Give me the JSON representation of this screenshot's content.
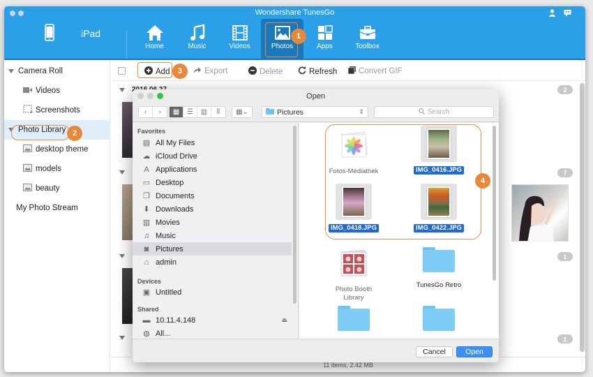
{
  "window": {
    "title": "Wondershare TunesGo",
    "device_label": "iPad"
  },
  "nav": [
    {
      "label": "Home",
      "icon": "home-icon"
    },
    {
      "label": "Music",
      "icon": "music-icon"
    },
    {
      "label": "Videos",
      "icon": "film-icon"
    },
    {
      "label": "Photos",
      "icon": "photo-icon",
      "active": true
    },
    {
      "label": "Apps",
      "icon": "apps-icon"
    },
    {
      "label": "Toolbox",
      "icon": "toolbox-icon"
    }
  ],
  "callouts": {
    "one": "1",
    "two": "2",
    "three": "3",
    "four": "4"
  },
  "sidebar": {
    "items": [
      {
        "label": "Camera Roll",
        "icon": "triangle-icon"
      },
      {
        "label": "Videos",
        "icon": "video-camera-icon"
      },
      {
        "label": "Screenshots",
        "icon": "screenshot-icon"
      },
      {
        "label": "Photo Library",
        "icon": "triangle-icon",
        "selected": true
      },
      {
        "label": "desktop theme",
        "icon": "album-icon"
      },
      {
        "label": "models",
        "icon": "album-icon"
      },
      {
        "label": "beauty",
        "icon": "album-icon"
      },
      {
        "label": "My Photo Stream",
        "icon": ""
      }
    ]
  },
  "toolbar": {
    "add": "Add",
    "export": "Export",
    "delete": "Delete",
    "refresh": "Refresh",
    "convert_gif": "Convert GIF"
  },
  "content": {
    "groups": [
      {
        "date": "2016.06.27",
        "count": "2"
      },
      {
        "date": "",
        "count": "7"
      },
      {
        "date": "",
        "count": "1"
      },
      {
        "date": "",
        "count": "1"
      }
    ],
    "status": "11 items, 2.42 MB"
  },
  "dialog": {
    "title": "Open",
    "location": "Pictures",
    "search_placeholder": "Search",
    "sections": {
      "favorites": "Favorites",
      "devices": "Devices",
      "shared": "Shared"
    },
    "favorites": [
      {
        "label": "All My Files",
        "icon": "all-files-icon"
      },
      {
        "label": "iCloud Drive",
        "icon": "cloud-icon"
      },
      {
        "label": "Applications",
        "icon": "applications-icon"
      },
      {
        "label": "Desktop",
        "icon": "desktop-icon"
      },
      {
        "label": "Documents",
        "icon": "documents-icon"
      },
      {
        "label": "Downloads",
        "icon": "downloads-icon"
      },
      {
        "label": "Movies",
        "icon": "movies-icon"
      },
      {
        "label": "Music",
        "icon": "music-icon"
      },
      {
        "label": "Pictures",
        "icon": "camera-icon",
        "selected": true
      },
      {
        "label": "admin",
        "icon": "home-icon"
      }
    ],
    "devices": [
      {
        "label": "Untitled",
        "icon": "disk-icon"
      }
    ],
    "shared": [
      {
        "label": "10.11.4.148",
        "icon": "monitor-icon"
      },
      {
        "label": "All...",
        "icon": "globe-icon"
      }
    ],
    "files": [
      {
        "name": "Fotos-Mediathek",
        "type": "library",
        "selected": false
      },
      {
        "name": "IMG_0416.JPG",
        "type": "image",
        "selected": true
      },
      {
        "name": "IMG_0418.JPG",
        "type": "image",
        "selected": true
      },
      {
        "name": "IMG_0422.JPG",
        "type": "image",
        "selected": true
      },
      {
        "name": "Photo Booth Library",
        "type": "library",
        "selected": false
      },
      {
        "name": "TunesGo Retro",
        "type": "folder",
        "selected": false
      },
      {
        "name": "",
        "type": "folder",
        "selected": false
      },
      {
        "name": "",
        "type": "folder",
        "selected": false
      }
    ],
    "cancel": "Cancel",
    "open": "Open"
  },
  "colors": {
    "brand_blue": "#2b9fe8",
    "active_tab": "#1a78bd",
    "callout_orange": "#e8883a",
    "selection_blue": "#1f6ad0"
  }
}
